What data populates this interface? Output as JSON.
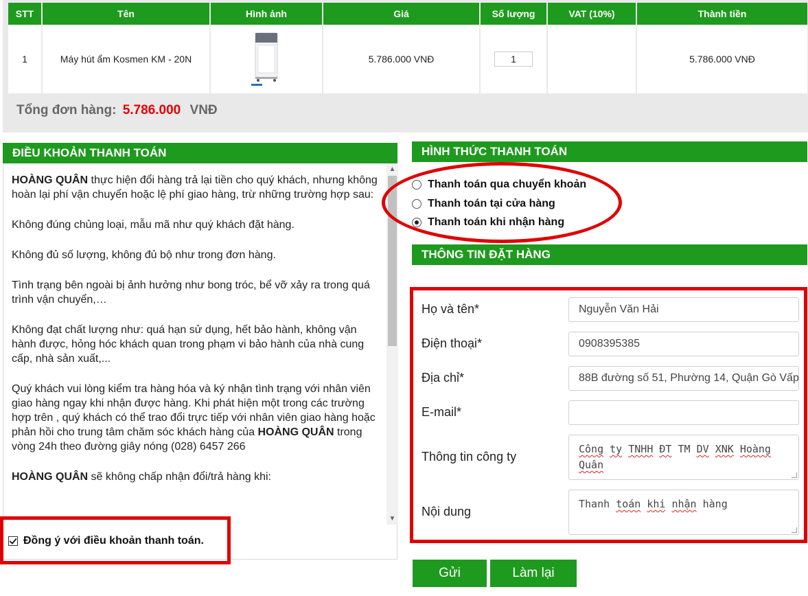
{
  "cart": {
    "headers": [
      "STT",
      "Tên",
      "Hình ảnh",
      "Giá",
      "Số lượng",
      "VAT (10%)",
      "Thành tiền"
    ],
    "row": {
      "stt": "1",
      "name": "Máy hút ẩm Kosmen KM - 20N",
      "price": "5.786.000 VNĐ",
      "quantity": "1",
      "vat": "",
      "subtotal": "5.786.000 VNĐ"
    },
    "total_label": "Tổng đơn hàng:",
    "total_amount": "5.786.000",
    "total_currency": "VNĐ"
  },
  "terms": {
    "heading": "ĐIỀU KHOẢN THANH TOÁN",
    "brand": "HOÀNG QUÂN",
    "p1_rest": " thực hiện đổi hàng trả lại tiền cho quý khách, nhưng không hoàn lại phí vận chuyển hoặc lệ phí giao hàng, trừ những trường hợp sau:",
    "p2": "Không đúng chủng loại, mẫu mã như quý khách đặt hàng.",
    "p3": "Không đủ số lượng, không đủ bộ như trong đơn hàng.",
    "p4": "Tình trạng bên ngoài bị ảnh hưởng như bong tróc, bể vỡ xảy ra trong quá trình vận chuyển,…",
    "p5": "Không đạt chất lượng như: quá hạn sử dụng, hết bảo hành, không vận hành được, hỏng hóc khách quan trong phạm vi bảo hành của nhà cung cấp, nhà sản xuất,...",
    "p6_start": "Quý khách vui lòng kiểm tra hàng hóa và ký nhận tình trạng với nhân viên giao hàng ngay khi nhận được hàng. Khi phát hiện một trong các trường hợp trên , quý khách có thể trao đổi trực tiếp với nhân viên giao hàng hoặc phản hồi cho trung tâm chăm sóc khách hàng của ",
    "p6_end": " trong vòng 24h theo đường giây nóng (028) 6457 266",
    "p7_rest": " sẽ không chấp nhận đổi/trả hàng khi:",
    "agree_label": "Đồng ý với điều khoản thanh toán."
  },
  "payment": {
    "heading": "HÌNH THỨC THANH TOÁN",
    "options": [
      {
        "label": "Thanh toán qua chuyển khoản",
        "selected": false
      },
      {
        "label": "Thanh toán tại cửa hàng",
        "selected": false
      },
      {
        "label": "Thanh toán khi nhận hàng",
        "selected": true
      }
    ]
  },
  "order": {
    "heading": "THÔNG TIN ĐẶT HÀNG",
    "name_label": "Họ và tên*",
    "name_value": "Nguyễn Văn Hải",
    "phone_label": "Điện thoại*",
    "phone_value": "0908395385",
    "address_label": "Địa chỉ*",
    "address_value": "88B đường số 51, Phường 14, Quận Gò Vấp",
    "email_label": "E-mail*",
    "email_value": "",
    "company_label": "Thông tin công ty",
    "company_words": [
      "Công",
      "ty",
      "TNHH",
      "ĐT",
      "TM",
      "DV",
      "XNK",
      "Hoàng",
      "Quân"
    ],
    "note_label": "Nội dung",
    "note_words": [
      "Thanh",
      "toán",
      "khi",
      "nhận",
      "hàng"
    ]
  },
  "buttons": {
    "submit": "Gửi",
    "reset": "Làm lại"
  },
  "colors": {
    "header_green": "#1e9a1e",
    "highlight_red": "#e00000",
    "total_red": "#e60000"
  }
}
